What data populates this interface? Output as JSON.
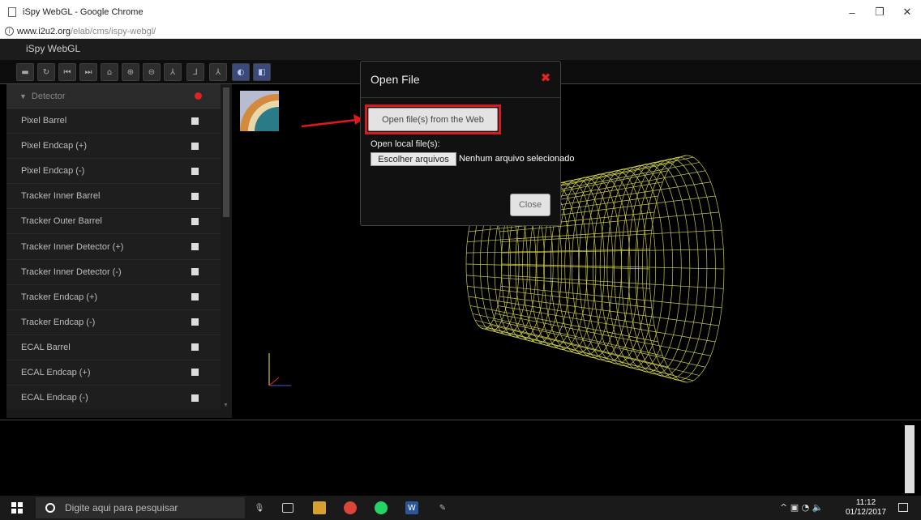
{
  "browser": {
    "window_title": "iSpy WebGL - Google Chrome",
    "url_host": "www.i2u2.org",
    "url_path": "/elab/cms/ispy-webgl/",
    "controls": {
      "minimize": "–",
      "restore": "❐",
      "close": "✕"
    }
  },
  "app": {
    "title": "iSpy WebGL"
  },
  "toolbar": {
    "buttons": [
      {
        "icon": "folder-open-icon",
        "glyph": "▬"
      },
      {
        "icon": "reload-icon",
        "glyph": "↻"
      },
      {
        "icon": "first-event-icon",
        "glyph": "⏮"
      },
      {
        "icon": "last-event-icon",
        "glyph": "⏭"
      },
      {
        "icon": "home-icon",
        "glyph": "⌂"
      },
      {
        "icon": "zoom-in-icon",
        "glyph": "⊕"
      },
      {
        "icon": "zoom-out-icon",
        "glyph": "⊖"
      },
      {
        "icon": "view-xyz-icon",
        "glyph": "⅄"
      },
      {
        "icon": "view-yz-icon",
        "glyph": "⅃"
      },
      {
        "icon": "view-xz-icon",
        "glyph": "⅄"
      },
      {
        "icon": "perspective-icon",
        "glyph": "◐"
      },
      {
        "icon": "orthographic-icon",
        "glyph": "◧"
      }
    ]
  },
  "sidebar": {
    "folder_label": "Detector",
    "items": [
      {
        "label": "Pixel Barrel"
      },
      {
        "label": "Pixel Endcap (+)"
      },
      {
        "label": "Pixel Endcap (-)"
      },
      {
        "label": "Tracker Inner Barrel"
      },
      {
        "label": "Tracker Outer Barrel"
      },
      {
        "label": "Tracker Inner Detector (+)"
      },
      {
        "label": "Tracker Inner Detector (-)"
      },
      {
        "label": "Tracker Endcap (+)"
      },
      {
        "label": "Tracker Endcap (-)"
      },
      {
        "label": "ECAL Barrel"
      },
      {
        "label": "ECAL Endcap (+)"
      },
      {
        "label": "ECAL Endcap (-)"
      }
    ]
  },
  "modal": {
    "title": "Open File",
    "web_button": "Open file(s) from the Web",
    "local_label": "Open local file(s):",
    "choose_button": "Escolher arquivos",
    "no_file_text": "Nenhum arquivo selecionado",
    "close_button": "Close"
  },
  "taskbar": {
    "search_placeholder": "Digite aqui para pesquisar",
    "time": "11:12",
    "date": "01/12/2017",
    "tray_icons": "^ ▣ ◔ 🔈"
  },
  "colors": {
    "wireframe": "#c8c84a",
    "highlight": "#d41e1e",
    "close_x": "#ee2222"
  }
}
